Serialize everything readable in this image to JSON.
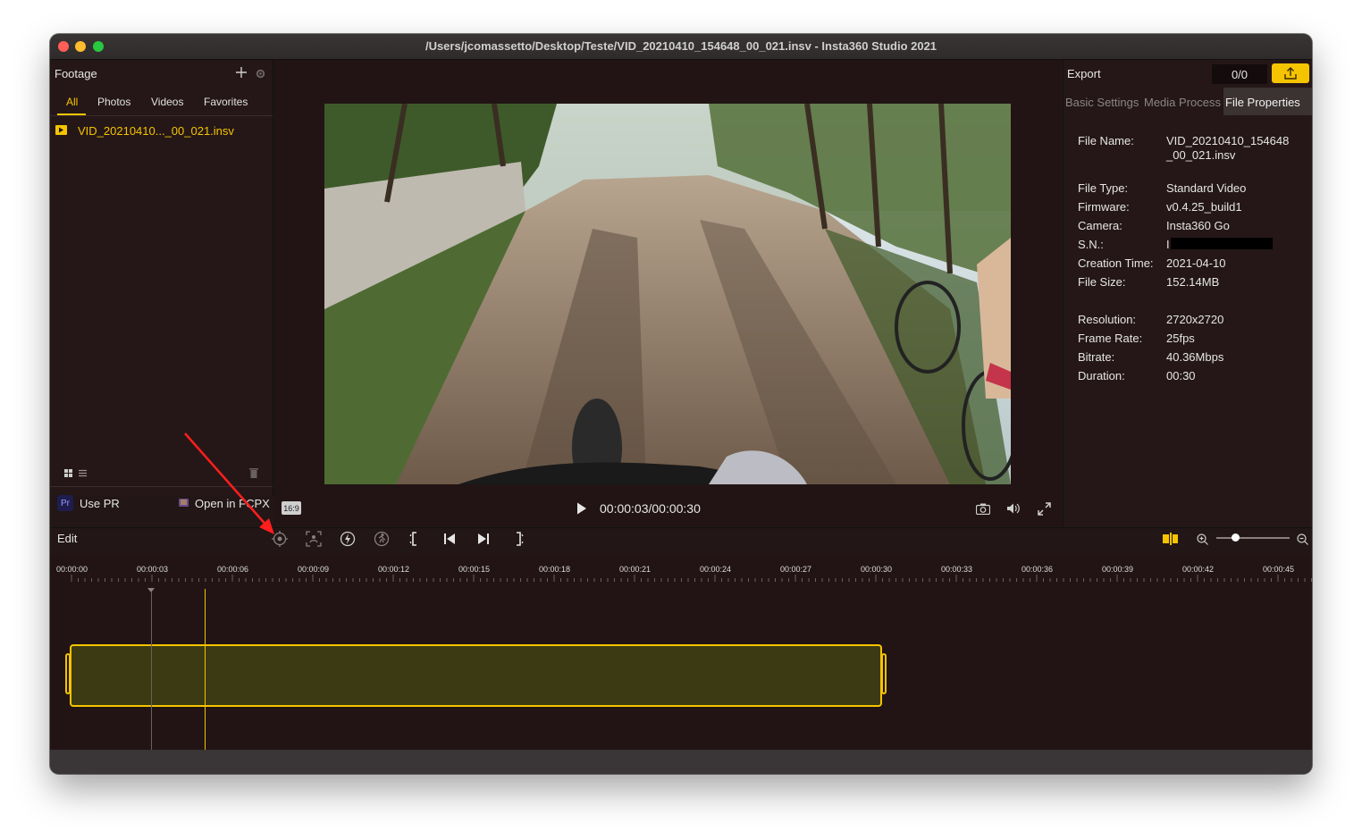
{
  "window": {
    "title": "/Users/jcomassetto/Desktop/Teste/VID_20210410_154648_00_021.insv - Insta360 Studio 2021"
  },
  "colors": {
    "accent": "#f5c400",
    "bg": "#221616",
    "clip_fill": "#3b3a12"
  },
  "footage": {
    "header": "Footage",
    "tabs": [
      {
        "label": "All",
        "active": true
      },
      {
        "label": "Photos"
      },
      {
        "label": "Videos"
      },
      {
        "label": "Favorites"
      }
    ],
    "items": [
      {
        "name": "VID_20210410..._00_021.insv"
      }
    ],
    "use_pr": "Use PR",
    "pr_badge": "Pr",
    "open_fcpx": "Open in FCPX"
  },
  "preview": {
    "aspect": "16:9",
    "timecode": "00:00:03/00:00:30"
  },
  "export": {
    "header": "Export",
    "counter": "0/0",
    "tabs": [
      {
        "label": "Basic Settings"
      },
      {
        "label": "Media Process"
      },
      {
        "label": "File Properties",
        "active": true
      }
    ]
  },
  "props": {
    "file_name_label": "File Name:",
    "file_name_1": "VID_20210410_154648",
    "file_name_2": "_00_021.insv",
    "file_type_label": "File Type:",
    "file_type": "Standard Video",
    "firmware_label": "Firmware:",
    "firmware": "v0.4.25_build1",
    "camera_label": "Camera:",
    "camera": "Insta360 Go",
    "sn_label": "S.N.:",
    "sn": "I",
    "creation_label": "Creation Time:",
    "creation": "2021-04-10",
    "size_label": "File Size:",
    "size": "152.14MB",
    "resolution_label": "Resolution:",
    "resolution": "2720x2720",
    "fps_label": "Frame Rate:",
    "fps": "25fps",
    "bitrate_label": "Bitrate:",
    "bitrate": "40.36Mbps",
    "duration_label": "Duration:",
    "duration": "00:30"
  },
  "edit": {
    "label": "Edit",
    "zoom_level": 0.25
  },
  "timeline": {
    "ticks": [
      "00:00:00",
      "00:00:03",
      "00:00:06",
      "00:00:09",
      "00:00:12",
      "00:00:15",
      "00:00:18",
      "00:00:21",
      "00:00:24",
      "00:00:27",
      "00:00:30",
      "00:00:33",
      "00:00:36",
      "00:00:39",
      "00:00:42",
      "00:00:45"
    ],
    "playhead": "00:00:03"
  }
}
